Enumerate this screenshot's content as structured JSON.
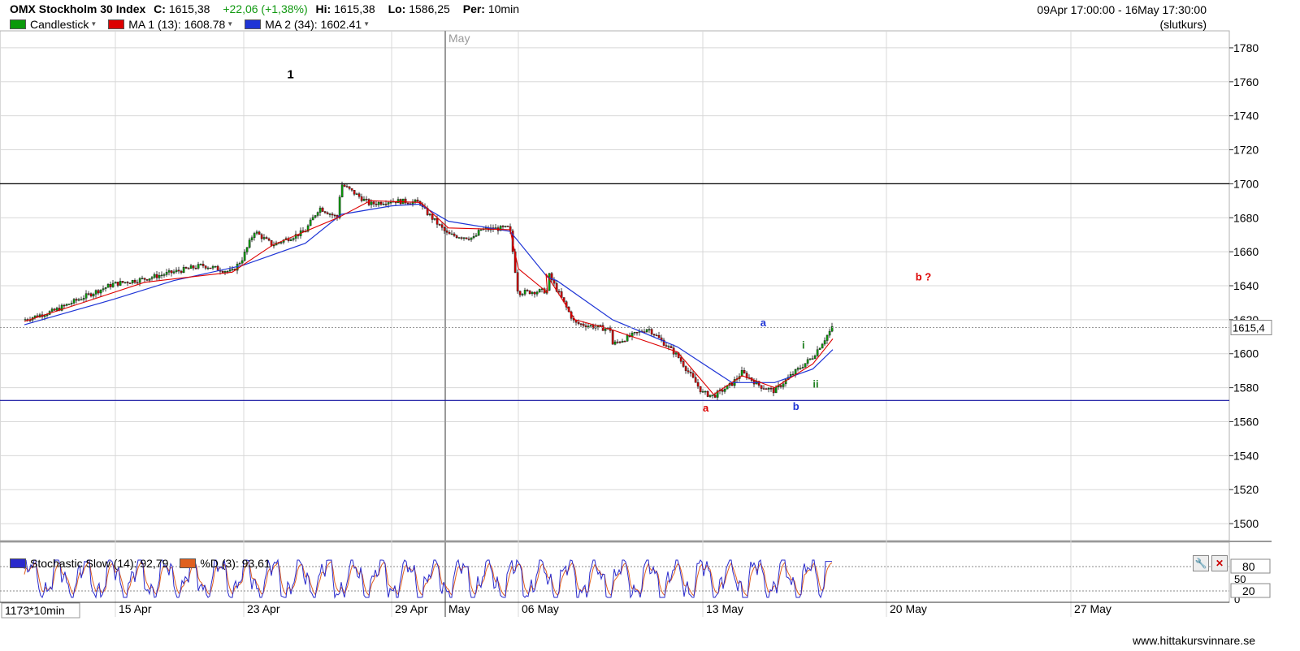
{
  "header": {
    "title": "OMX Stockholm 30 Index",
    "close_label": "C:",
    "close_value": "1615,38",
    "change": "+22,06 (+1,38%)",
    "high_label": "Hi:",
    "high_value": "1615,38",
    "low_label": "Lo:",
    "low_value": "1586,25",
    "period_label": "Per:",
    "period_value": "10min",
    "date_range": "09Apr 17:00:00 - 16May 17:30:00",
    "price_mode": "(slutkurs)"
  },
  "legend": {
    "candlestick": "Candlestick",
    "ma1": "MA 1 (13): 1608.78",
    "ma2": "MA 2 (34): 1602.41",
    "stoch": "Stochastic Slow (14): 92,79",
    "pctd": "%D (3): 93,61"
  },
  "footer": {
    "bar_count": "1173*10min",
    "site": "www.hittakursvinnare.se"
  },
  "colors": {
    "candle_up": "#0a9a0a",
    "candle_down": "#cc0000",
    "ma1": "#dd0000",
    "ma2": "#1f35d6",
    "stoch": "#2a2acc",
    "pctd": "#e06020",
    "hline_black": "#000000",
    "hline_blue": "#1010a0",
    "wave_red": "#dd0000",
    "wave_blue": "#1f35d6",
    "wave_green": "#208020"
  },
  "chart_data": {
    "type": "candlestick",
    "y_axis": {
      "ylim": [
        1490,
        1790
      ],
      "ticks": [
        1500,
        1520,
        1540,
        1560,
        1580,
        1600,
        1620,
        1640,
        1660,
        1680,
        1700,
        1720,
        1740,
        1760,
        1780
      ]
    },
    "last_price_label": "1615,4",
    "x_labels": [
      "15 Apr",
      "23 Apr",
      "29 Apr",
      "May",
      "06 May",
      "13 May",
      "20 May",
      "27 May"
    ],
    "month_marker": "May",
    "horizontal_lines": [
      1700,
      1572.5
    ],
    "price_series": {
      "name": "Close",
      "points": [
        [
          "10 Apr 09:00",
          1620
        ],
        [
          "10 Apr 17:00",
          1625
        ],
        [
          "11 Apr 17:00",
          1633
        ],
        [
          "12 Apr 17:00",
          1641
        ],
        [
          "15 Apr 17:00",
          1644
        ],
        [
          "16 Apr 17:00",
          1648
        ],
        [
          "17 Apr 17:00",
          1652
        ],
        [
          "18 Apr 17:00",
          1648
        ],
        [
          "22 Apr 17:00",
          1656
        ],
        [
          "23 Apr 12:00",
          1672
        ],
        [
          "23 Apr 17:00",
          1664
        ],
        [
          "24 Apr 17:00",
          1672
        ],
        [
          "25 Apr 12:00",
          1686
        ],
        [
          "25 Apr 17:00",
          1680
        ],
        [
          "26 Apr 09:00",
          1700
        ],
        [
          "26 Apr 17:00",
          1688
        ],
        [
          "29 Apr 09:00",
          1690
        ],
        [
          "29 Apr 17:00",
          1689
        ],
        [
          "30 Apr 09:00",
          1688
        ],
        [
          "30 Apr 17:00",
          1670
        ],
        [
          "02 May 17:00",
          1668
        ],
        [
          "03 May 09:00",
          1673
        ],
        [
          "03 May 17:00",
          1674
        ],
        [
          "06 May 09:00",
          1636
        ],
        [
          "06 May 17:00",
          1637
        ],
        [
          "07 May 09:00",
          1650
        ],
        [
          "07 May 17:00",
          1618
        ],
        [
          "08 May 17:00",
          1614
        ],
        [
          "09 May 09:00",
          1605
        ],
        [
          "10 May 09:00",
          1615
        ],
        [
          "10 May 17:00",
          1599
        ],
        [
          "13 May 09:00",
          1577
        ],
        [
          "13 May 12:00",
          1575
        ],
        [
          "13 May 17:00",
          1582
        ],
        [
          "14 May 12:00",
          1589
        ],
        [
          "14 May 17:00",
          1581
        ],
        [
          "15 May 12:00",
          1578
        ],
        [
          "15 May 17:00",
          1588
        ],
        [
          "16 May 12:00",
          1598
        ],
        [
          "16 May 17:30",
          1615.4
        ]
      ]
    },
    "ma1": {
      "name": "MA 1 (13)",
      "points": [
        [
          "10 Apr 09:00",
          1619
        ],
        [
          "11 Apr 17:00",
          1630
        ],
        [
          "15 Apr 17:00",
          1642
        ],
        [
          "18 Apr 17:00",
          1648
        ],
        [
          "23 Apr 17:00",
          1664
        ],
        [
          "25 Apr 17:00",
          1680
        ],
        [
          "26 Apr 17:00",
          1690
        ],
        [
          "29 Apr 17:00",
          1689
        ],
        [
          "30 Apr 17:00",
          1674
        ],
        [
          "03 May 17:00",
          1673
        ],
        [
          "06 May 09:00",
          1650
        ],
        [
          "06 May 17:00",
          1636
        ],
        [
          "07 May 09:00",
          1647
        ],
        [
          "07 May 17:00",
          1620
        ],
        [
          "08 May 17:00",
          1614
        ],
        [
          "10 May 17:00",
          1601
        ],
        [
          "13 May 12:00",
          1576
        ],
        [
          "14 May 12:00",
          1587
        ],
        [
          "15 May 12:00",
          1580
        ],
        [
          "16 May 12:00",
          1594
        ],
        [
          "16 May 17:30",
          1608.78
        ]
      ]
    },
    "ma2": {
      "name": "MA 2 (34)",
      "points": [
        [
          "10 Apr 09:00",
          1617
        ],
        [
          "12 Apr 17:00",
          1632
        ],
        [
          "16 Apr 17:00",
          1643
        ],
        [
          "22 Apr 17:00",
          1652
        ],
        [
          "24 Apr 17:00",
          1665
        ],
        [
          "26 Apr 09:00",
          1682
        ],
        [
          "29 Apr 09:00",
          1687
        ],
        [
          "30 Apr 09:00",
          1688
        ],
        [
          "30 Apr 17:00",
          1678
        ],
        [
          "03 May 17:00",
          1672
        ],
        [
          "06 May 17:00",
          1645
        ],
        [
          "07 May 12:00",
          1643
        ],
        [
          "08 May 17:00",
          1620
        ],
        [
          "10 May 17:00",
          1604
        ],
        [
          "13 May 17:00",
          1583
        ],
        [
          "15 May 12:00",
          1583
        ],
        [
          "16 May 12:00",
          1591
        ],
        [
          "16 May 17:30",
          1602.41
        ]
      ]
    },
    "annotations": [
      {
        "text": "1",
        "color": "#000000",
        "at": [
          "24 Apr 12:00",
          1762
        ]
      },
      {
        "text": "b ?",
        "color": "#dd0000",
        "at": [
          "20 May 17:00",
          1643
        ]
      },
      {
        "text": "a",
        "color": "#1f35d6",
        "at": [
          "14 May 17:00",
          1616
        ]
      },
      {
        "text": "i",
        "color": "#208020",
        "at": [
          "16 May 09:00",
          1603
        ]
      },
      {
        "text": "ii",
        "color": "#208020",
        "at": [
          "16 May 12:00",
          1580
        ]
      },
      {
        "text": "a",
        "color": "#dd0000",
        "at": [
          "13 May 09:00",
          1566
        ]
      },
      {
        "text": "b",
        "color": "#1f35d6",
        "at": [
          "15 May 17:00",
          1567
        ]
      }
    ],
    "stochastic": {
      "name": "Stochastic Slow (14)",
      "ylim": [
        0,
        100
      ],
      "ticks": [
        0,
        20,
        50,
        80
      ],
      "last": 92.79,
      "pctd_last": 93.61,
      "levels": [
        20,
        80
      ]
    }
  }
}
